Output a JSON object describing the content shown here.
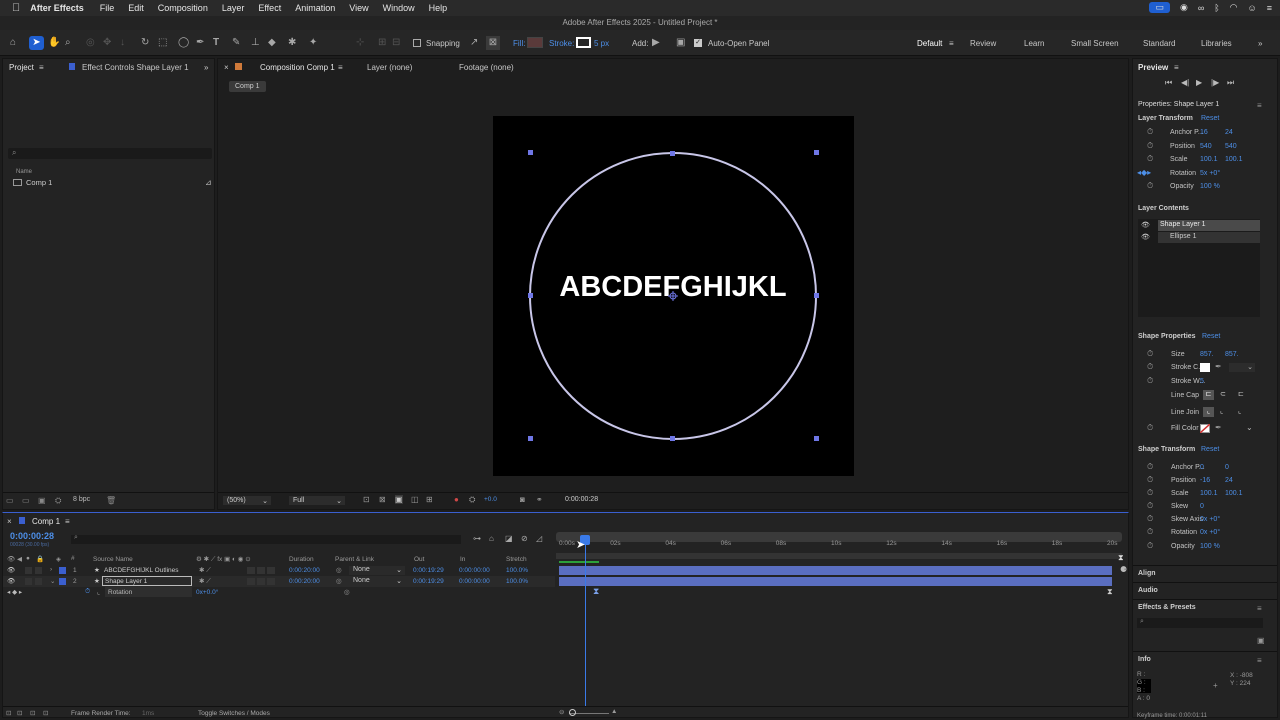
{
  "menubar": {
    "apple": "",
    "app": "After Effects",
    "items": [
      "File",
      "Edit",
      "Composition",
      "Layer",
      "Effect",
      "Animation",
      "View",
      "Window",
      "Help"
    ]
  },
  "window_title": "Adobe After Effects 2025 - Untitled Project *",
  "toolbar": {
    "snapping": "Snapping",
    "fill": "Fill:",
    "stroke": "Stroke:",
    "stroke_width": "5 px",
    "add": "Add:",
    "auto_open": "Auto-Open Panel"
  },
  "workspaces": [
    "Default",
    "Review",
    "Learn",
    "Small Screen",
    "Standard",
    "Libraries"
  ],
  "project": {
    "tab": "Project",
    "tab2": "Effect Controls Shape Layer 1",
    "col_name": "Name",
    "item": "Comp 1",
    "search_placeholder": ""
  },
  "comp": {
    "tab": "Composition Comp 1",
    "tab_layer": "Layer (none)",
    "tab_footage": "Footage (none)",
    "breadcrumb": "Comp 1",
    "text": "ABCDEFGHIJKL",
    "bpc": "8 bpc",
    "zoom": "(50%)",
    "quality": "Full",
    "timecode": "0:00:00:28",
    "exposure": "+0.0"
  },
  "preview": {
    "title": "Preview"
  },
  "props": {
    "title": "Properties: Shape Layer 1",
    "layer_transform": "Layer Transform",
    "reset": "Reset",
    "anchor": {
      "label": "Anchor P...",
      "v1": "16",
      "v2": "24"
    },
    "position": {
      "label": "Position",
      "v1": "540",
      "v2": "540"
    },
    "scale": {
      "label": "Scale",
      "v1": "100.1",
      "v2": "100.1"
    },
    "rotation": {
      "label": "Rotation",
      "v": "5x +0°"
    },
    "opacity": {
      "label": "Opacity",
      "v": "100 %"
    },
    "layer_contents": "Layer Contents",
    "lc_items": [
      "Shape Layer 1",
      "Ellipse 1"
    ],
    "shape_props": "Shape Properties",
    "size": {
      "label": "Size",
      "v1": "857.",
      "v2": "857."
    },
    "stroke_color": "Stroke C...",
    "stroke_w": "Stroke W...",
    "stroke_w_val": "5",
    "line_cap": "Line Cap",
    "line_join": "Line Join",
    "fill_color": "Fill Color",
    "shape_transform": "Shape Transform",
    "st_anchor": {
      "label": "Anchor P...",
      "v1": "0",
      "v2": "0"
    },
    "st_position": {
      "label": "Position",
      "v1": "-16",
      "v2": "24"
    },
    "st_scale": {
      "label": "Scale",
      "v1": "100.1",
      "v2": "100.1"
    },
    "st_skew": {
      "label": "Skew",
      "v": "0"
    },
    "st_skew_axis": {
      "label": "Skew Axis",
      "v": "0x +0°"
    },
    "st_rotation": {
      "label": "Rotation",
      "v": "0x +0°"
    },
    "st_opacity": {
      "label": "Opacity",
      "v": "100 %"
    }
  },
  "side": {
    "align": "Align",
    "audio": "Audio",
    "effects": "Effects & Presets",
    "info": "Info",
    "info_r": "R :",
    "info_g": "G :",
    "info_b": "B :",
    "info_a": "A : 0",
    "info_x": "X : -808",
    "info_y": "Y : 224",
    "keyframe": "Keyframe time: 0:00:01:11"
  },
  "timeline": {
    "tab": "Comp 1",
    "timecode": "0:00:00:28",
    "fps": "00028 (30.00 fps)",
    "cols": {
      "source": "Source Name",
      "duration": "Duration",
      "parent": "Parent & Link",
      "out": "Out",
      "in": "In",
      "stretch": "Stretch"
    },
    "layers": [
      {
        "num": "1",
        "name": "ABCDEFGHIJKL Outlines",
        "duration": "0:00:20:00",
        "parent": "None",
        "out": "0:00:19:29",
        "in": "0:00:00:00",
        "stretch": "100.0%"
      },
      {
        "num": "2",
        "name": "Shape Layer 1",
        "duration": "0:00:20:00",
        "parent": "None",
        "out": "0:00:19:29",
        "in": "0:00:00:00",
        "stretch": "100.0%"
      }
    ],
    "prop_rotation": {
      "label": "Rotation",
      "value": "0x+0.0°"
    },
    "ticks": [
      "0:00s",
      "02s",
      "04s",
      "06s",
      "08s",
      "10s",
      "12s",
      "14s",
      "16s",
      "18s",
      "20s"
    ],
    "footer_left": "Frame Render Time:",
    "footer_ms": "1ms",
    "footer_toggle": "Toggle Switches / Modes"
  }
}
